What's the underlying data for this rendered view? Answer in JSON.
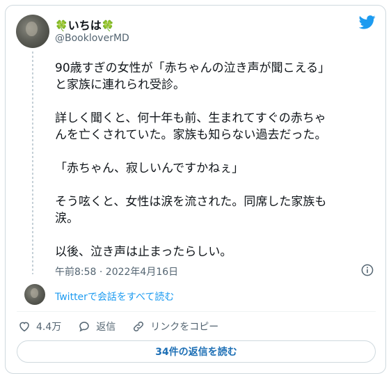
{
  "tweet": {
    "display_name": "いちは",
    "display_prefix_emoji": "🍀",
    "display_suffix_emoji": "🍀",
    "handle": "@BookloverMD",
    "paragraphs": [
      "90歳すぎの女性が「赤ちゃんの泣き声が聞こえる」\nと家族に連れられ受診。",
      "詳しく聞くと、何十年も前、生まれてすぐの赤ちゃ\nんを亡くされていた。家族も知らない過去だった。",
      "「赤ちゃん、寂しいんですかねぇ」",
      "そう呟くと、女性は涙を流された。同席した家族も\n涙。",
      "以後、泣き声は止まったらしい。"
    ],
    "timestamp": "午前8:58 · 2022年4月16日",
    "thread_link": "Twitterで会話をすべて読む",
    "like_count": "4.4万",
    "reply_label": "返信",
    "copy_link_label": "リンクをコピー",
    "read_replies_label": "34件の返信を読む"
  },
  "colors": {
    "accent": "#1d9bf0",
    "text": "#0f1419",
    "muted": "#536471",
    "border": "#cfd9de",
    "clover": "#3c9a3a"
  },
  "icons": [
    "twitter-bird-icon",
    "info-icon",
    "heart-icon",
    "reply-bubble-icon",
    "link-icon"
  ]
}
